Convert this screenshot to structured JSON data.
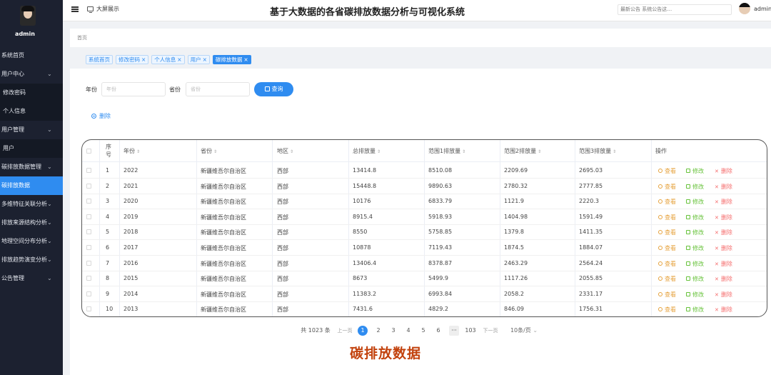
{
  "sidebar": {
    "username": "admin",
    "items": [
      {
        "label": "系统首页",
        "type": "top",
        "chevron": false
      },
      {
        "label": "用户中心",
        "type": "top",
        "chevron": true
      },
      {
        "label": "修改密码",
        "type": "sub",
        "chevron": false
      },
      {
        "label": "个人信息",
        "type": "sub",
        "chevron": false
      },
      {
        "label": "用户管理",
        "type": "top",
        "chevron": true
      },
      {
        "label": "用户",
        "type": "sub",
        "chevron": false
      },
      {
        "label": "碳排放数据管理",
        "type": "top",
        "chevron": true
      },
      {
        "label": "碳排放数据",
        "type": "active",
        "chevron": false
      },
      {
        "label": "多维特征关联分析",
        "type": "top",
        "chevron": true
      },
      {
        "label": "排放来源结构分析",
        "type": "top",
        "chevron": true
      },
      {
        "label": "地理空间分布分析",
        "type": "top",
        "chevron": true
      },
      {
        "label": "排放趋势演变分析",
        "type": "top",
        "chevron": true
      },
      {
        "label": "公告管理",
        "type": "top",
        "chevron": true
      }
    ]
  },
  "header": {
    "big_screen_label": "大屏展示",
    "title": "基于大数据的各省碳排放数据分析与可视化系统",
    "notice": "最新公告 系统公告这…",
    "username": "admin"
  },
  "breadcrumb": "首页",
  "tags": [
    {
      "label": "系统首页",
      "closable": false,
      "active": false
    },
    {
      "label": "修改密码",
      "closable": true,
      "active": false
    },
    {
      "label": "个人信息",
      "closable": true,
      "active": false
    },
    {
      "label": "用户",
      "closable": true,
      "active": false
    },
    {
      "label": "碳排放数据",
      "closable": true,
      "active": true
    }
  ],
  "search": {
    "year_label": "年份",
    "year_placeholder": "年份",
    "province_label": "省份",
    "province_placeholder": "省份",
    "query_button": "查询",
    "delete_button": "删除"
  },
  "table": {
    "headers": [
      "序号",
      "年份",
      "省份",
      "地区",
      "总排放量",
      "范围1排放量",
      "范围2排放量",
      "范围3排放量",
      "操作"
    ],
    "rows": [
      [
        "1",
        "2022",
        "新疆维吾尔自治区",
        "西部",
        "13414.8",
        "8510.08",
        "2209.69",
        "2695.03"
      ],
      [
        "2",
        "2021",
        "新疆维吾尔自治区",
        "西部",
        "15448.8",
        "9890.63",
        "2780.32",
        "2777.85"
      ],
      [
        "3",
        "2020",
        "新疆维吾尔自治区",
        "西部",
        "10176",
        "6833.79",
        "1121.9",
        "2220.3"
      ],
      [
        "4",
        "2019",
        "新疆维吾尔自治区",
        "西部",
        "8915.4",
        "5918.93",
        "1404.98",
        "1591.49"
      ],
      [
        "5",
        "2018",
        "新疆维吾尔自治区",
        "西部",
        "8550",
        "5758.85",
        "1379.8",
        "1411.35"
      ],
      [
        "6",
        "2017",
        "新疆维吾尔自治区",
        "西部",
        "10878",
        "7119.43",
        "1874.5",
        "1884.07"
      ],
      [
        "7",
        "2016",
        "新疆维吾尔自治区",
        "西部",
        "13406.4",
        "8378.87",
        "2463.29",
        "2564.24"
      ],
      [
        "8",
        "2015",
        "新疆维吾尔自治区",
        "西部",
        "8673",
        "5499.9",
        "1117.26",
        "2055.85"
      ],
      [
        "9",
        "2014",
        "新疆维吾尔自治区",
        "西部",
        "11383.2",
        "6993.84",
        "2058.2",
        "2331.17"
      ],
      [
        "10",
        "2013",
        "新疆维吾尔自治区",
        "西部",
        "7431.6",
        "4829.2",
        "846.09",
        "1756.31"
      ]
    ],
    "actions": {
      "view": "查看",
      "edit": "修改",
      "delete": "删除"
    },
    "colors": {
      "view": "#e6a23c",
      "edit": "#67c23a",
      "delete": "#f56c6c"
    }
  },
  "pagination": {
    "total": "共 1023 条",
    "prev": "上一页",
    "pages": [
      "1",
      "2",
      "3",
      "4",
      "5",
      "6"
    ],
    "current": "1",
    "ellipsis": "···",
    "last": "103",
    "next": "下一页",
    "page_size": "10条/页"
  },
  "caption": "碳排放数据",
  "colors": {
    "primary": "#2f8cf0",
    "sidebar_bg": "#1c2130",
    "caption": "#c2410c"
  }
}
